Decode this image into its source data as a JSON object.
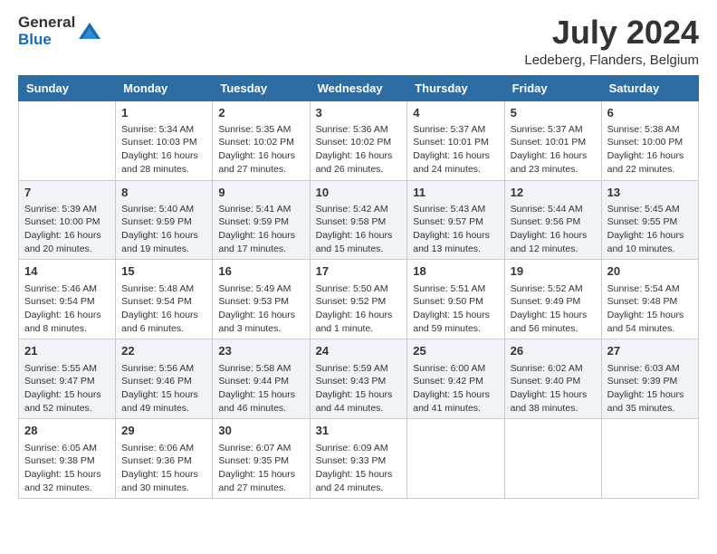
{
  "header": {
    "logo_general": "General",
    "logo_blue": "Blue",
    "month_title": "July 2024",
    "location": "Ledeberg, Flanders, Belgium"
  },
  "weekdays": [
    "Sunday",
    "Monday",
    "Tuesday",
    "Wednesday",
    "Thursday",
    "Friday",
    "Saturday"
  ],
  "weeks": [
    [
      {
        "day": "",
        "content": ""
      },
      {
        "day": "1",
        "content": "Sunrise: 5:34 AM\nSunset: 10:03 PM\nDaylight: 16 hours\nand 28 minutes."
      },
      {
        "day": "2",
        "content": "Sunrise: 5:35 AM\nSunset: 10:02 PM\nDaylight: 16 hours\nand 27 minutes."
      },
      {
        "day": "3",
        "content": "Sunrise: 5:36 AM\nSunset: 10:02 PM\nDaylight: 16 hours\nand 26 minutes."
      },
      {
        "day": "4",
        "content": "Sunrise: 5:37 AM\nSunset: 10:01 PM\nDaylight: 16 hours\nand 24 minutes."
      },
      {
        "day": "5",
        "content": "Sunrise: 5:37 AM\nSunset: 10:01 PM\nDaylight: 16 hours\nand 23 minutes."
      },
      {
        "day": "6",
        "content": "Sunrise: 5:38 AM\nSunset: 10:00 PM\nDaylight: 16 hours\nand 22 minutes."
      }
    ],
    [
      {
        "day": "7",
        "content": "Sunrise: 5:39 AM\nSunset: 10:00 PM\nDaylight: 16 hours\nand 20 minutes."
      },
      {
        "day": "8",
        "content": "Sunrise: 5:40 AM\nSunset: 9:59 PM\nDaylight: 16 hours\nand 19 minutes."
      },
      {
        "day": "9",
        "content": "Sunrise: 5:41 AM\nSunset: 9:59 PM\nDaylight: 16 hours\nand 17 minutes."
      },
      {
        "day": "10",
        "content": "Sunrise: 5:42 AM\nSunset: 9:58 PM\nDaylight: 16 hours\nand 15 minutes."
      },
      {
        "day": "11",
        "content": "Sunrise: 5:43 AM\nSunset: 9:57 PM\nDaylight: 16 hours\nand 13 minutes."
      },
      {
        "day": "12",
        "content": "Sunrise: 5:44 AM\nSunset: 9:56 PM\nDaylight: 16 hours\nand 12 minutes."
      },
      {
        "day": "13",
        "content": "Sunrise: 5:45 AM\nSunset: 9:55 PM\nDaylight: 16 hours\nand 10 minutes."
      }
    ],
    [
      {
        "day": "14",
        "content": "Sunrise: 5:46 AM\nSunset: 9:54 PM\nDaylight: 16 hours\nand 8 minutes."
      },
      {
        "day": "15",
        "content": "Sunrise: 5:48 AM\nSunset: 9:54 PM\nDaylight: 16 hours\nand 6 minutes."
      },
      {
        "day": "16",
        "content": "Sunrise: 5:49 AM\nSunset: 9:53 PM\nDaylight: 16 hours\nand 3 minutes."
      },
      {
        "day": "17",
        "content": "Sunrise: 5:50 AM\nSunset: 9:52 PM\nDaylight: 16 hours\nand 1 minute."
      },
      {
        "day": "18",
        "content": "Sunrise: 5:51 AM\nSunset: 9:50 PM\nDaylight: 15 hours\nand 59 minutes."
      },
      {
        "day": "19",
        "content": "Sunrise: 5:52 AM\nSunset: 9:49 PM\nDaylight: 15 hours\nand 56 minutes."
      },
      {
        "day": "20",
        "content": "Sunrise: 5:54 AM\nSunset: 9:48 PM\nDaylight: 15 hours\nand 54 minutes."
      }
    ],
    [
      {
        "day": "21",
        "content": "Sunrise: 5:55 AM\nSunset: 9:47 PM\nDaylight: 15 hours\nand 52 minutes."
      },
      {
        "day": "22",
        "content": "Sunrise: 5:56 AM\nSunset: 9:46 PM\nDaylight: 15 hours\nand 49 minutes."
      },
      {
        "day": "23",
        "content": "Sunrise: 5:58 AM\nSunset: 9:44 PM\nDaylight: 15 hours\nand 46 minutes."
      },
      {
        "day": "24",
        "content": "Sunrise: 5:59 AM\nSunset: 9:43 PM\nDaylight: 15 hours\nand 44 minutes."
      },
      {
        "day": "25",
        "content": "Sunrise: 6:00 AM\nSunset: 9:42 PM\nDaylight: 15 hours\nand 41 minutes."
      },
      {
        "day": "26",
        "content": "Sunrise: 6:02 AM\nSunset: 9:40 PM\nDaylight: 15 hours\nand 38 minutes."
      },
      {
        "day": "27",
        "content": "Sunrise: 6:03 AM\nSunset: 9:39 PM\nDaylight: 15 hours\nand 35 minutes."
      }
    ],
    [
      {
        "day": "28",
        "content": "Sunrise: 6:05 AM\nSunset: 9:38 PM\nDaylight: 15 hours\nand 32 minutes."
      },
      {
        "day": "29",
        "content": "Sunrise: 6:06 AM\nSunset: 9:36 PM\nDaylight: 15 hours\nand 30 minutes."
      },
      {
        "day": "30",
        "content": "Sunrise: 6:07 AM\nSunset: 9:35 PM\nDaylight: 15 hours\nand 27 minutes."
      },
      {
        "day": "31",
        "content": "Sunrise: 6:09 AM\nSunset: 9:33 PM\nDaylight: 15 hours\nand 24 minutes."
      },
      {
        "day": "",
        "content": ""
      },
      {
        "day": "",
        "content": ""
      },
      {
        "day": "",
        "content": ""
      }
    ]
  ]
}
